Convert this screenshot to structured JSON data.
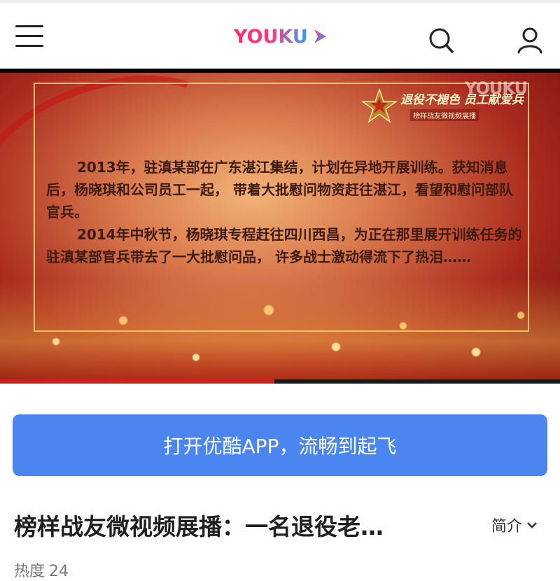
{
  "header": {
    "logo_text": "YOUKU",
    "menu_icon": "menu-icon",
    "search_icon": "search-icon",
    "user_icon": "user-icon",
    "brand_color": "#ff2a6a"
  },
  "video": {
    "watermark": "YOUKU",
    "badge_title": "退役不褪色 员工献爱兵",
    "badge_subtitle": "榜样战友微视频展播",
    "paragraphs": [
      "2013年，驻滇某部在广东湛江集结，计划在异地开展训练。获知消息后，杨晓琪和公司员工一起， 带着大批慰问物资赶往湛江，看望和慰问部队官兵。",
      "2014年中秋节，杨晓琪专程赶往四川西昌，为正在那里展开训练任务的驻滇某部官兵带去了一大批慰问品， 许多战士激动得流下了热泪……"
    ],
    "progress_fraction": 0.49
  },
  "open_app_button": "打开优酷APP，流畅到起飞",
  "video_title": "榜样战友微视频展播：一名退役老…",
  "intro_label": "简介",
  "heat_label": "热度",
  "heat_value": "24",
  "accent_color": "#4a85f0"
}
